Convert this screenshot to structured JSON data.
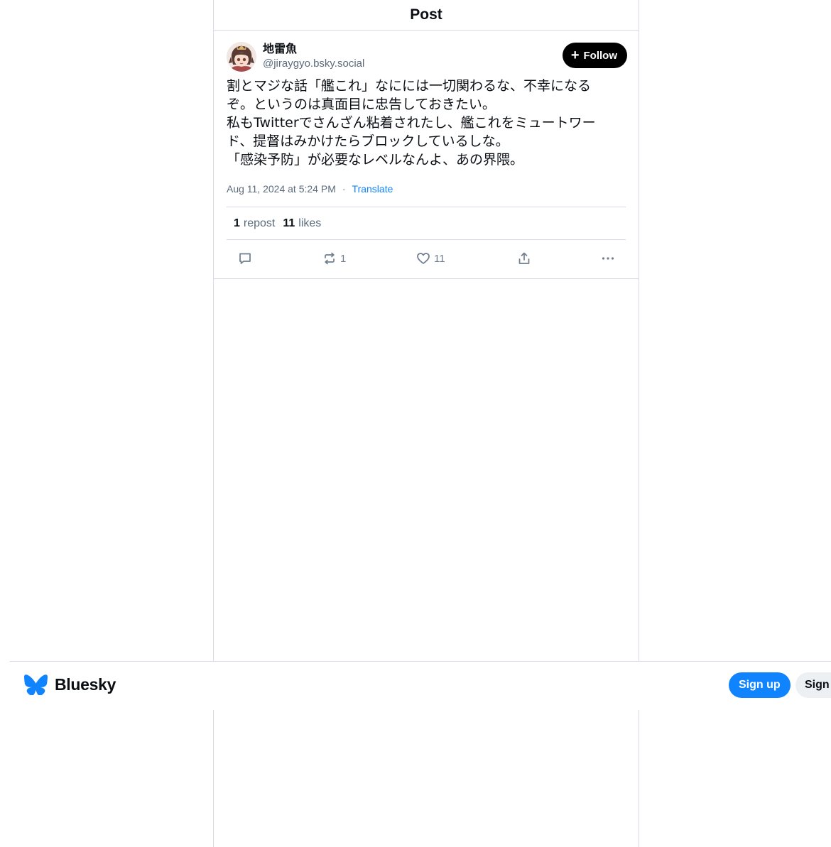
{
  "header": {
    "title": "Post"
  },
  "post": {
    "author": {
      "display_name": "地雷魚",
      "handle": "@jiraygyo.bsky.social"
    },
    "follow_label": "Follow",
    "text": "割とマジな話「艦これ」なにには一切関わるな、不幸になる\nぞ。というのは真面目に忠告しておきたい。\n私もTwitterでさんざん粘着されたし、艦これをミュートワー\nド、提督はみかけたらブロックしているしな。\n「感染予防」が必要なレベルなんよ、あの界隈。",
    "timestamp": "Aug 11, 2024 at 5:24 PM",
    "separator": "·",
    "translate_label": "Translate",
    "stats": {
      "reposts_count": "1",
      "reposts_label": "repost",
      "likes_count": "11",
      "likes_label": "likes"
    },
    "actions": {
      "reply_icon": "reply-icon",
      "repost_icon": "repost-icon",
      "repost_count": "1",
      "like_icon": "heart-icon",
      "like_count": "11",
      "share_icon": "share-icon",
      "more_icon": "more-icon"
    }
  },
  "footer": {
    "brand_name": "Bluesky",
    "signup_label": "Sign up",
    "signin_label": "Sign in"
  },
  "colors": {
    "accent": "#1083fe",
    "text": "#0b0f14",
    "muted": "#5b6b7c",
    "border": "#d4dbe2"
  }
}
